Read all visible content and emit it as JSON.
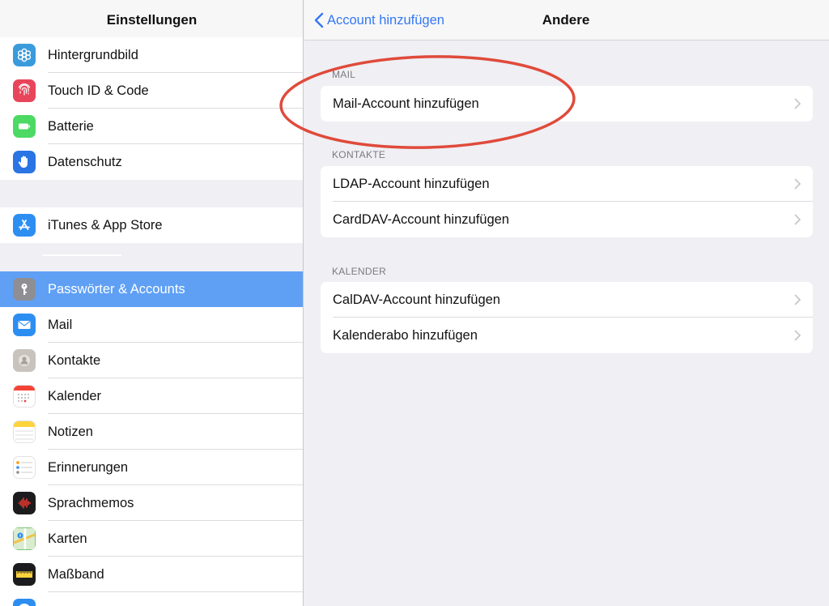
{
  "sidebar": {
    "title": "Einstellungen",
    "group1": [
      {
        "label": "Hintergrundbild",
        "icon": "wallpaper-flower-icon",
        "color": "#3a9bdc"
      },
      {
        "label": "Touch ID & Code",
        "icon": "fingerprint-icon",
        "color": "#e8455b"
      },
      {
        "label": "Batterie",
        "icon": "battery-icon",
        "color": "#4cd964"
      },
      {
        "label": "Datenschutz",
        "icon": "hand-icon",
        "color": "#2a74e4"
      }
    ],
    "group2": [
      {
        "label": "iTunes & App Store",
        "icon": "app-store-icon",
        "color": "#2d8ef2"
      }
    ],
    "group3": [
      {
        "label": "Passwörter & Accounts",
        "icon": "key-icon",
        "color": "#8e8e93",
        "selected": true
      },
      {
        "label": "Mail",
        "icon": "mail-icon",
        "color": "#2d8ef2"
      },
      {
        "label": "Kontakte",
        "icon": "contacts-icon",
        "color": "#c8c4bd"
      },
      {
        "label": "Kalender",
        "icon": "calendar-icon",
        "color": "#ffffff"
      },
      {
        "label": "Notizen",
        "icon": "notes-icon",
        "color": "#fdd33b"
      },
      {
        "label": "Erinnerungen",
        "icon": "reminders-icon",
        "color": "#ffffff"
      },
      {
        "label": "Sprachmemos",
        "icon": "voice-memos-icon",
        "color": "#1c1c1e"
      },
      {
        "label": "Karten",
        "icon": "maps-icon",
        "color": "#7cc576"
      },
      {
        "label": "Maßband",
        "icon": "measure-icon",
        "color": "#1c1c1e"
      }
    ]
  },
  "detail": {
    "back_label": "Account hinzufügen",
    "title": "Andere",
    "sections": [
      {
        "header": "MAIL",
        "rows": [
          "Mail-Account hinzufügen"
        ]
      },
      {
        "header": "KONTAKTE",
        "rows": [
          "LDAP-Account hinzufügen",
          "CardDAV-Account hinzufügen"
        ]
      },
      {
        "header": "KALENDER",
        "rows": [
          "CalDAV-Account hinzufügen",
          "Kalenderabo hinzufügen"
        ]
      }
    ]
  },
  "colors": {
    "accent": "#3478f6",
    "selected_row": "#5fa0f5",
    "annotation": "#e04a3a"
  }
}
